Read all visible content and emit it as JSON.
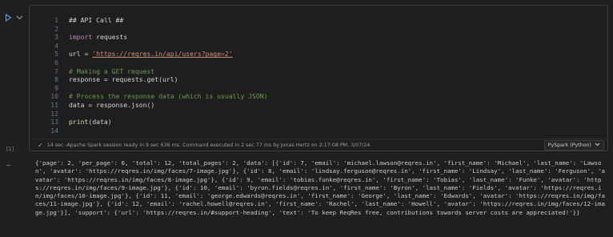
{
  "cell": {
    "execution_count": "[1]",
    "lines": [
      {
        "n": "1",
        "parts": [
          {
            "t": "## API Call ##",
            "c": "txt"
          }
        ]
      },
      {
        "n": "2",
        "parts": []
      },
      {
        "n": "3",
        "parts": [
          {
            "t": "import",
            "c": "kw"
          },
          {
            "t": " requests",
            "c": "txt"
          }
        ]
      },
      {
        "n": "4",
        "parts": []
      },
      {
        "n": "5",
        "parts": [
          {
            "t": "url = ",
            "c": "txt"
          },
          {
            "t": "'https://reqres.in/api/users?page=2'",
            "c": "str"
          }
        ]
      },
      {
        "n": "6",
        "parts": []
      },
      {
        "n": "7",
        "parts": [
          {
            "t": "# Making a GET request",
            "c": "cm"
          }
        ]
      },
      {
        "n": "8",
        "parts": [
          {
            "t": "response = requests.get(url)",
            "c": "txt"
          }
        ]
      },
      {
        "n": "9",
        "parts": []
      },
      {
        "n": "10",
        "parts": [
          {
            "t": "# Process the response data (which is usually JSON)",
            "c": "cm"
          }
        ]
      },
      {
        "n": "11",
        "parts": [
          {
            "t": "data = response.json()",
            "c": "txt"
          }
        ]
      },
      {
        "n": "12",
        "parts": []
      },
      {
        "n": "13",
        "parts": [
          {
            "t": "print",
            "c": "fn"
          },
          {
            "t": "(data)",
            "c": "txt"
          }
        ]
      },
      {
        "n": "14",
        "parts": []
      }
    ],
    "status_text": "14 sec -Apache Spark session ready in 9 sec 636 ms. Command executed in 2 sec 77 ms by Jonas Hertz on 2:17:08 PM, 3/07/24",
    "language": "PySpark (Python)"
  },
  "output": {
    "text": "{'page': 2, 'per_page': 6, 'total': 12, 'total_pages': 2, 'data': [{'id': 7, 'email': 'michael.lawson@reqres.in', 'first_name': 'Michael', 'last_name': 'Lawson', 'avatar': 'https://reqres.in/img/faces/7-image.jpg'}, {'id': 8, 'email': 'lindsay.ferguson@reqres.in', 'first_name': 'Lindsay', 'last_name': 'Ferguson', 'avatar': 'https://reqres.in/img/faces/8-image.jpg'}, {'id': 9, 'email': 'tobias.funke@reqres.in', 'first_name': 'Tobias', 'last_name': 'Funke', 'avatar': 'https://reqres.in/img/faces/9-image.jpg'}, {'id': 10, 'email': 'byron.fields@reqres.in', 'first_name': 'Byron', 'last_name': 'Fields', 'avatar': 'https://reqres.in/img/faces/10-image.jpg'}, {'id': 11, 'email': 'george.edwards@reqres.in', 'first_name': 'George', 'last_name': 'Edwards', 'avatar': 'https://reqres.in/img/faces/11-image.jpg'}, {'id': 12, 'email': 'rachel.howell@reqres.in', 'first_name': 'Rachel', 'last_name': 'Howell', 'avatar': 'https://reqres.in/img/faces/12-image.jpg'}], 'support': {'url': 'https://reqres.in/#support-heading', 'text': 'To keep ReqRes free, contributions towards server costs are appreciated!'}}"
  },
  "icons": {
    "run": "play-icon",
    "collapse": "chevron-down-icon",
    "status": "check-icon",
    "more_output": "ellipsis-icon"
  },
  "colors": {
    "background": "#1f1f1f",
    "comment": "#6a9955",
    "keyword": "#c586c0",
    "string": "#ce9178",
    "success": "#89d185"
  }
}
